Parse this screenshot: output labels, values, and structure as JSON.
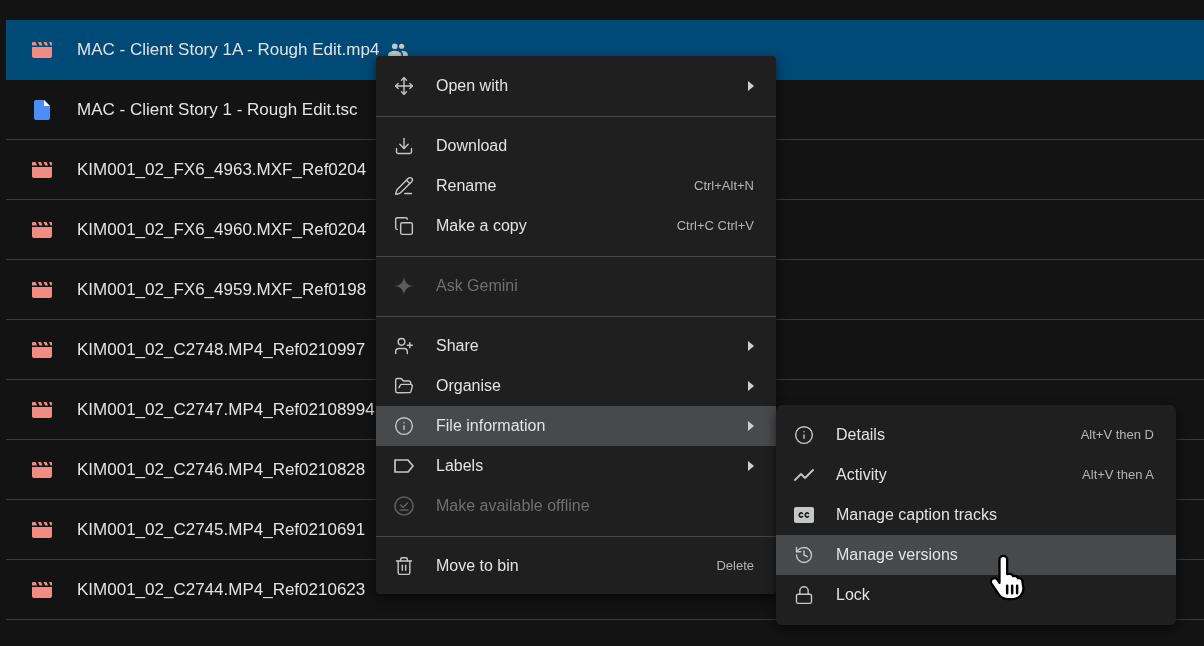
{
  "files": [
    {
      "name": "MAC - Client Story 1A - Rough Edit.mp4",
      "kind": "video",
      "shared": true,
      "selected": true
    },
    {
      "name": "MAC - Client Story 1 - Rough Edit.tsc",
      "kind": "document",
      "shared": false,
      "selected": false
    },
    {
      "name": "KIM001_02_FX6_4963.MXF_Ref0204",
      "kind": "video",
      "shared": false,
      "selected": false
    },
    {
      "name": "KIM001_02_FX6_4960.MXF_Ref0204",
      "kind": "video",
      "shared": false,
      "selected": false
    },
    {
      "name": "KIM001_02_FX6_4959.MXF_Ref0198",
      "kind": "video",
      "shared": false,
      "selected": false
    },
    {
      "name": "KIM001_02_C2748.MP4_Ref0210997",
      "kind": "video",
      "shared": false,
      "selected": false
    },
    {
      "name": "KIM001_02_C2747.MP4_Ref02108994",
      "kind": "video",
      "shared": false,
      "selected": false
    },
    {
      "name": "KIM001_02_C2746.MP4_Ref0210828",
      "kind": "video",
      "shared": false,
      "selected": false
    },
    {
      "name": "KIM001_02_C2745.MP4_Ref0210691",
      "kind": "video",
      "shared": false,
      "selected": false
    },
    {
      "name": "KIM001_02_C2744.MP4_Ref0210623",
      "kind": "video",
      "shared": false,
      "selected": false
    }
  ],
  "context_menu": {
    "groups": [
      {
        "items": [
          {
            "label": "Open with",
            "submenu": true,
            "disabled": false,
            "selected": false
          }
        ]
      },
      {
        "items": [
          {
            "label": "Download",
            "submenu": false,
            "disabled": false,
            "selected": false
          },
          {
            "label": "Rename",
            "shortcut": "Ctrl+Alt+N",
            "submenu": false,
            "disabled": false,
            "selected": false
          },
          {
            "label": "Make a copy",
            "shortcut": "Ctrl+C Ctrl+V",
            "submenu": false,
            "disabled": false,
            "selected": false
          }
        ]
      },
      {
        "items": [
          {
            "label": "Ask Gemini",
            "submenu": false,
            "disabled": true,
            "selected": false
          }
        ]
      },
      {
        "items": [
          {
            "label": "Share",
            "submenu": true,
            "disabled": false,
            "selected": false
          },
          {
            "label": "Organise",
            "submenu": true,
            "disabled": false,
            "selected": false
          },
          {
            "label": "File information",
            "submenu": true,
            "disabled": false,
            "selected": true
          },
          {
            "label": "Labels",
            "submenu": true,
            "disabled": false,
            "selected": false
          },
          {
            "label": "Make available offline",
            "submenu": false,
            "disabled": true,
            "selected": false
          }
        ]
      },
      {
        "items": [
          {
            "label": "Move to bin",
            "shortcut": "Delete",
            "submenu": false,
            "disabled": false,
            "selected": false
          }
        ]
      }
    ]
  },
  "submenu": {
    "items": [
      {
        "label": "Details",
        "shortcut": "Alt+V then D",
        "disabled": false,
        "selected": false
      },
      {
        "label": "Activity",
        "shortcut": "Alt+V then A",
        "disabled": false,
        "selected": false
      },
      {
        "label": "Manage caption tracks",
        "disabled": false,
        "selected": false
      },
      {
        "label": "Manage versions",
        "disabled": false,
        "selected": true
      },
      {
        "label": "Lock",
        "disabled": false,
        "selected": false
      }
    ]
  }
}
